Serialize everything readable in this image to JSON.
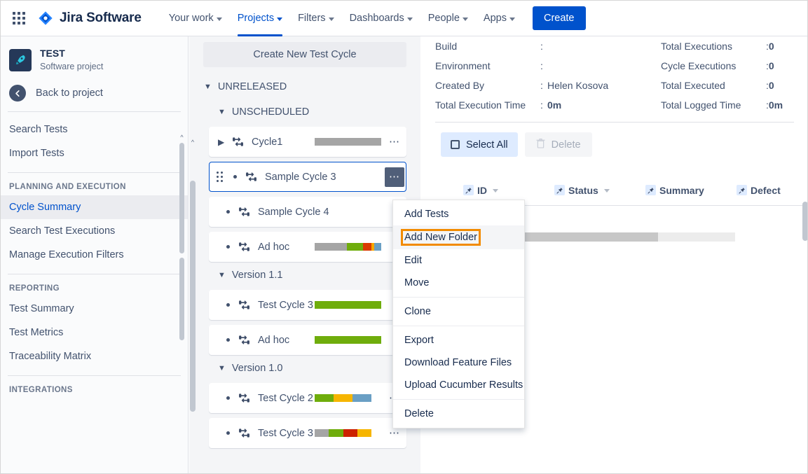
{
  "topnav": {
    "appswitcher_icon": "grid-icon",
    "brand": "Jira Software",
    "links": [
      {
        "label": "Your work",
        "has_caret": true,
        "active": false
      },
      {
        "label": "Projects",
        "has_caret": true,
        "active": true
      },
      {
        "label": "Filters",
        "has_caret": true,
        "active": false
      },
      {
        "label": "Dashboards",
        "has_caret": true,
        "active": false
      },
      {
        "label": "People",
        "has_caret": true,
        "active": false
      },
      {
        "label": "Apps",
        "has_caret": true,
        "active": false
      }
    ],
    "create_label": "Create"
  },
  "sidebar": {
    "project_key": "TEST",
    "project_type": "Software project",
    "back_label": "Back to project",
    "items_top": [
      {
        "label": "Search Tests"
      },
      {
        "label": "Import Tests"
      }
    ],
    "section_planning": "PLANNING AND EXECUTION",
    "items_planning": [
      {
        "label": "Cycle Summary",
        "selected": true
      },
      {
        "label": "Search Test Executions",
        "selected": false
      },
      {
        "label": "Manage Execution Filters",
        "selected": false
      }
    ],
    "section_reporting": "REPORTING",
    "items_reporting": [
      {
        "label": "Test Summary"
      },
      {
        "label": "Test Metrics"
      },
      {
        "label": "Traceability Matrix"
      }
    ],
    "section_integrations": "INTEGRATIONS"
  },
  "tree": {
    "create_cycle_label": "Create New Test Cycle",
    "group_unreleased": "UNRELEASED",
    "group_unscheduled": "UNSCHEDULED",
    "group_more_icon": "ellipsis-icon",
    "version_11": "Version 1.1",
    "version_10": "Version 1.0",
    "cycles": [
      {
        "name": "Cycle1",
        "expandable": true,
        "selected": false,
        "bar": [
          {
            "color": "#a5a5a5",
            "pct": 100
          }
        ]
      },
      {
        "name": "Sample Cycle 3",
        "expandable": false,
        "selected": true,
        "bar": []
      },
      {
        "name": "Sample Cycle 4",
        "expandable": false,
        "selected": false,
        "bar": []
      },
      {
        "name": "Ad hoc",
        "expandable": false,
        "selected": false,
        "bar": [
          {
            "color": "#a5a5a5",
            "pct": 48
          },
          {
            "color": "#6fad0c",
            "pct": 25
          },
          {
            "color": "#d93a00",
            "pct": 12
          },
          {
            "color": "#f6a700",
            "pct": 4
          },
          {
            "color": "#6a9fc4",
            "pct": 11
          }
        ]
      },
      {
        "name": "Test Cycle 3",
        "expandable": false,
        "selected": false,
        "bar": [
          {
            "color": "#6fad0c",
            "pct": 100
          }
        ]
      },
      {
        "name": "Ad hoc",
        "expandable": false,
        "selected": false,
        "bar": [
          {
            "color": "#6fad0c",
            "pct": 100
          }
        ]
      },
      {
        "name": "Test Cycle 2",
        "expandable": false,
        "selected": false,
        "bar": [
          {
            "color": "#6fad0c",
            "pct": 33
          },
          {
            "color": "#f6b500",
            "pct": 34
          },
          {
            "color": "#6a9fc4",
            "pct": 33
          }
        ]
      },
      {
        "name": "Test Cycle 3",
        "expandable": false,
        "selected": false,
        "bar": [
          {
            "color": "#a5a5a5",
            "pct": 25
          },
          {
            "color": "#6fad0c",
            "pct": 25
          },
          {
            "color": "#cc2200",
            "pct": 25
          },
          {
            "color": "#f6b500",
            "pct": 25
          }
        ]
      }
    ]
  },
  "context_menu": {
    "items": [
      {
        "label": "Add Tests",
        "highlighted": false,
        "sep_after": false
      },
      {
        "label": "Add New Folder",
        "highlighted": true,
        "sep_after": false
      },
      {
        "label": "Edit",
        "highlighted": false,
        "sep_after": false
      },
      {
        "label": "Move",
        "highlighted": false,
        "sep_after": true
      },
      {
        "label": "Clone",
        "highlighted": false,
        "sep_after": true
      },
      {
        "label": "Export",
        "highlighted": false,
        "sep_after": false
      },
      {
        "label": "Download Feature Files",
        "highlighted": false,
        "sep_after": false
      },
      {
        "label": "Upload Cucumber Results",
        "highlighted": false,
        "sep_after": true
      },
      {
        "label": "Delete",
        "highlighted": false,
        "sep_after": false
      }
    ]
  },
  "content": {
    "details_left": [
      {
        "label": "Build",
        "value": ""
      },
      {
        "label": "Environment",
        "value": ""
      },
      {
        "label": "Created By",
        "value": "Helen Kosova"
      },
      {
        "label": "Total Execution Time",
        "value": "0m"
      }
    ],
    "details_right": [
      {
        "label": "Total Executions",
        "value": "0"
      },
      {
        "label": "Cycle Executions",
        "value": "0"
      },
      {
        "label": "Total Executed",
        "value": "0"
      },
      {
        "label": "Total Logged Time",
        "value": "0m"
      }
    ],
    "select_all_label": "Select All",
    "delete_label": "Delete",
    "delete_icon": "trash-icon",
    "checkbox_icon": "checkbox-icon",
    "table_headers": [
      {
        "label": "ID",
        "pin_icon": "pin-icon",
        "has_caret": true
      },
      {
        "label": "Status",
        "pin_icon": "pin-icon",
        "has_caret": true
      },
      {
        "label": "Summary",
        "pin_icon": "pin-icon",
        "has_caret": false
      },
      {
        "label": "Defect",
        "pin_icon": "pin-icon",
        "has_caret": false
      }
    ]
  },
  "colors": {
    "brand_blue": "#0052cc",
    "highlight_orange": "#f28b00",
    "selected_sidebar": "#ebecf0",
    "panel_gray": "#f4f5f7"
  }
}
